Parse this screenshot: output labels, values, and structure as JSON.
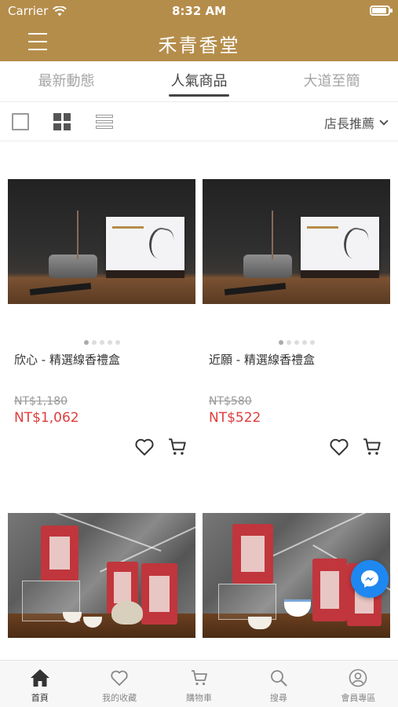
{
  "status_bar": {
    "carrier": "Carrier",
    "time": "8:32 AM",
    "battery_level": 0.9
  },
  "header": {
    "title": "禾青香堂"
  },
  "tabs": [
    {
      "label": "最新動態",
      "active": false
    },
    {
      "label": "人氣商品",
      "active": true
    },
    {
      "label": "大道至簡",
      "active": false
    }
  ],
  "toolbar": {
    "sort_label": "店長推薦"
  },
  "products": [
    {
      "name": "欣心 - 精選線香禮盒",
      "price_old": "NT$1,180",
      "price_new": "NT$1,062",
      "image_pages": 5,
      "current_page": 1
    },
    {
      "name": "近願 - 精選線香禮盒",
      "price_old": "NT$580",
      "price_new": "NT$522",
      "image_pages": 5,
      "current_page": 1
    },
    {
      "name": "",
      "price_old": "",
      "price_new": ""
    },
    {
      "name": "",
      "price_old": "",
      "price_new": ""
    }
  ],
  "bottom_nav": [
    {
      "label": "首頁",
      "icon": "home-icon",
      "active": true
    },
    {
      "label": "我的收藏",
      "icon": "heart-icon",
      "active": false
    },
    {
      "label": "購物車",
      "icon": "cart-icon",
      "active": false
    },
    {
      "label": "搜尋",
      "icon": "search-icon",
      "active": false
    },
    {
      "label": "會員專區",
      "icon": "user-icon",
      "active": false
    }
  ],
  "colors": {
    "brand": "#b58d4b",
    "price": "#e03c3c",
    "messenger": "#1e88f0"
  }
}
